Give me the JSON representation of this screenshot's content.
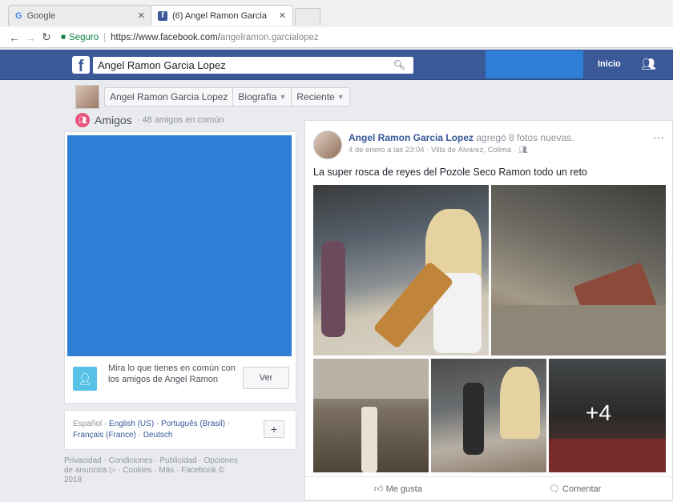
{
  "browser": {
    "tabs": [
      {
        "icon": "G",
        "label": "Google"
      },
      {
        "icon": "f",
        "label": "(6) Angel Ramon Garcia"
      }
    ],
    "address": {
      "secure_label": "Seguro",
      "url_base": "https://www.facebook.com/",
      "url_path": "angelramon.garcialopez"
    }
  },
  "fb_header": {
    "logo": "f",
    "search_value": "Angel Ramon Garcia Lopez",
    "home_label": "Inicio"
  },
  "profile_nav": {
    "name": "Angel Ramon Garcia Lopez",
    "biography": "Biografía",
    "recent": "Reciente"
  },
  "friends": {
    "title": "Amigos",
    "count": "· 48 amigos en común",
    "mutual_text": "Mira lo que tienes en común con los amigos de Angel Ramon",
    "view_button": "Ver"
  },
  "languages": {
    "current": "Español",
    "others": "· English (US) · Português (Brasil) · Français (France) · Deutsch"
  },
  "footer": {
    "links": "Privacidad · Condiciones · Publicidad · Opciones de anuncios ▷ · Cookies · Más · Facebook © 2018"
  },
  "post": {
    "author": "Angel Ramon Garcia Lopez",
    "action": "agregó 8 fotos nuevas.",
    "meta": "4 de enero a las 23:04 · Villa de Álvarez, Colima · ",
    "text": "La super rosca de reyes del Pozole Seco Ramon todo un reto",
    "more_photos": "+4",
    "like_label": "Me gusta",
    "comment_label": "Comentar"
  }
}
